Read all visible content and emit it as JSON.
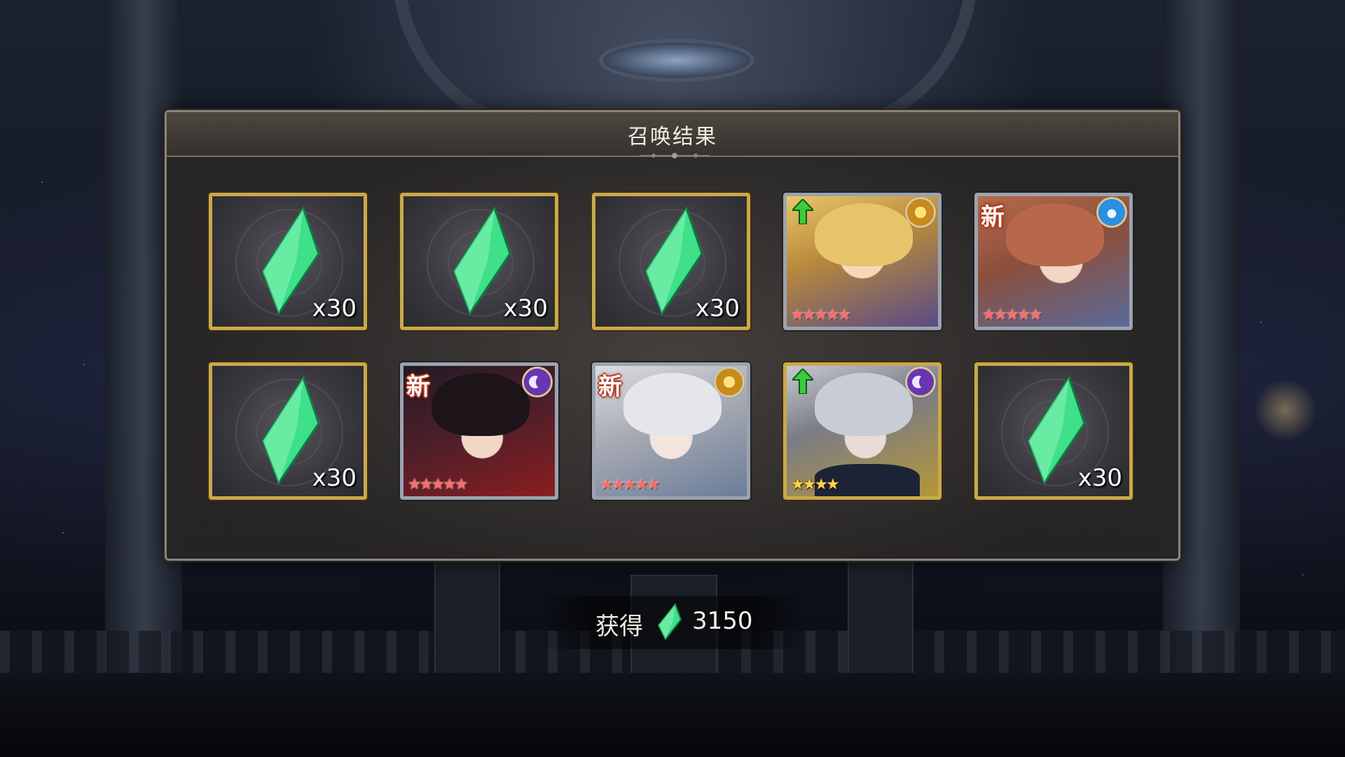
{
  "dialog": {
    "title": "召唤结果"
  },
  "results": [
    {
      "type": "crystal",
      "quantity": "x30",
      "frame": "gold"
    },
    {
      "type": "crystal",
      "quantity": "x30",
      "frame": "gold"
    },
    {
      "type": "crystal",
      "quantity": "x30",
      "frame": "gold"
    },
    {
      "type": "character",
      "badge": "up-arrow",
      "element": "sun-icon",
      "stars": 5,
      "frame": "silver"
    },
    {
      "type": "character",
      "badge": "新",
      "element": "water-icon",
      "stars": 5,
      "frame": "silver"
    },
    {
      "type": "crystal",
      "quantity": "x30",
      "frame": "gold"
    },
    {
      "type": "character",
      "badge": "新",
      "element": "moon-icon",
      "stars": 5,
      "frame": "silver"
    },
    {
      "type": "character",
      "badge": "新",
      "element": "sun-icon",
      "stars": 5,
      "frame": "silver"
    },
    {
      "type": "character",
      "badge": "up-arrow",
      "element": "moon-icon",
      "stars": 4,
      "frame": "gold"
    },
    {
      "type": "crystal",
      "quantity": "x30",
      "frame": "gold"
    }
  ],
  "summary": {
    "label": "获得",
    "currency_icon": "crystal-icon",
    "value": "3150"
  },
  "colors": {
    "crystal_green": "#3fe08a",
    "gold_frame": "#c9a94a",
    "silver_frame": "#9ba3b0",
    "new_badge": "#b3391e",
    "up_arrow": "#3ccc3c"
  }
}
